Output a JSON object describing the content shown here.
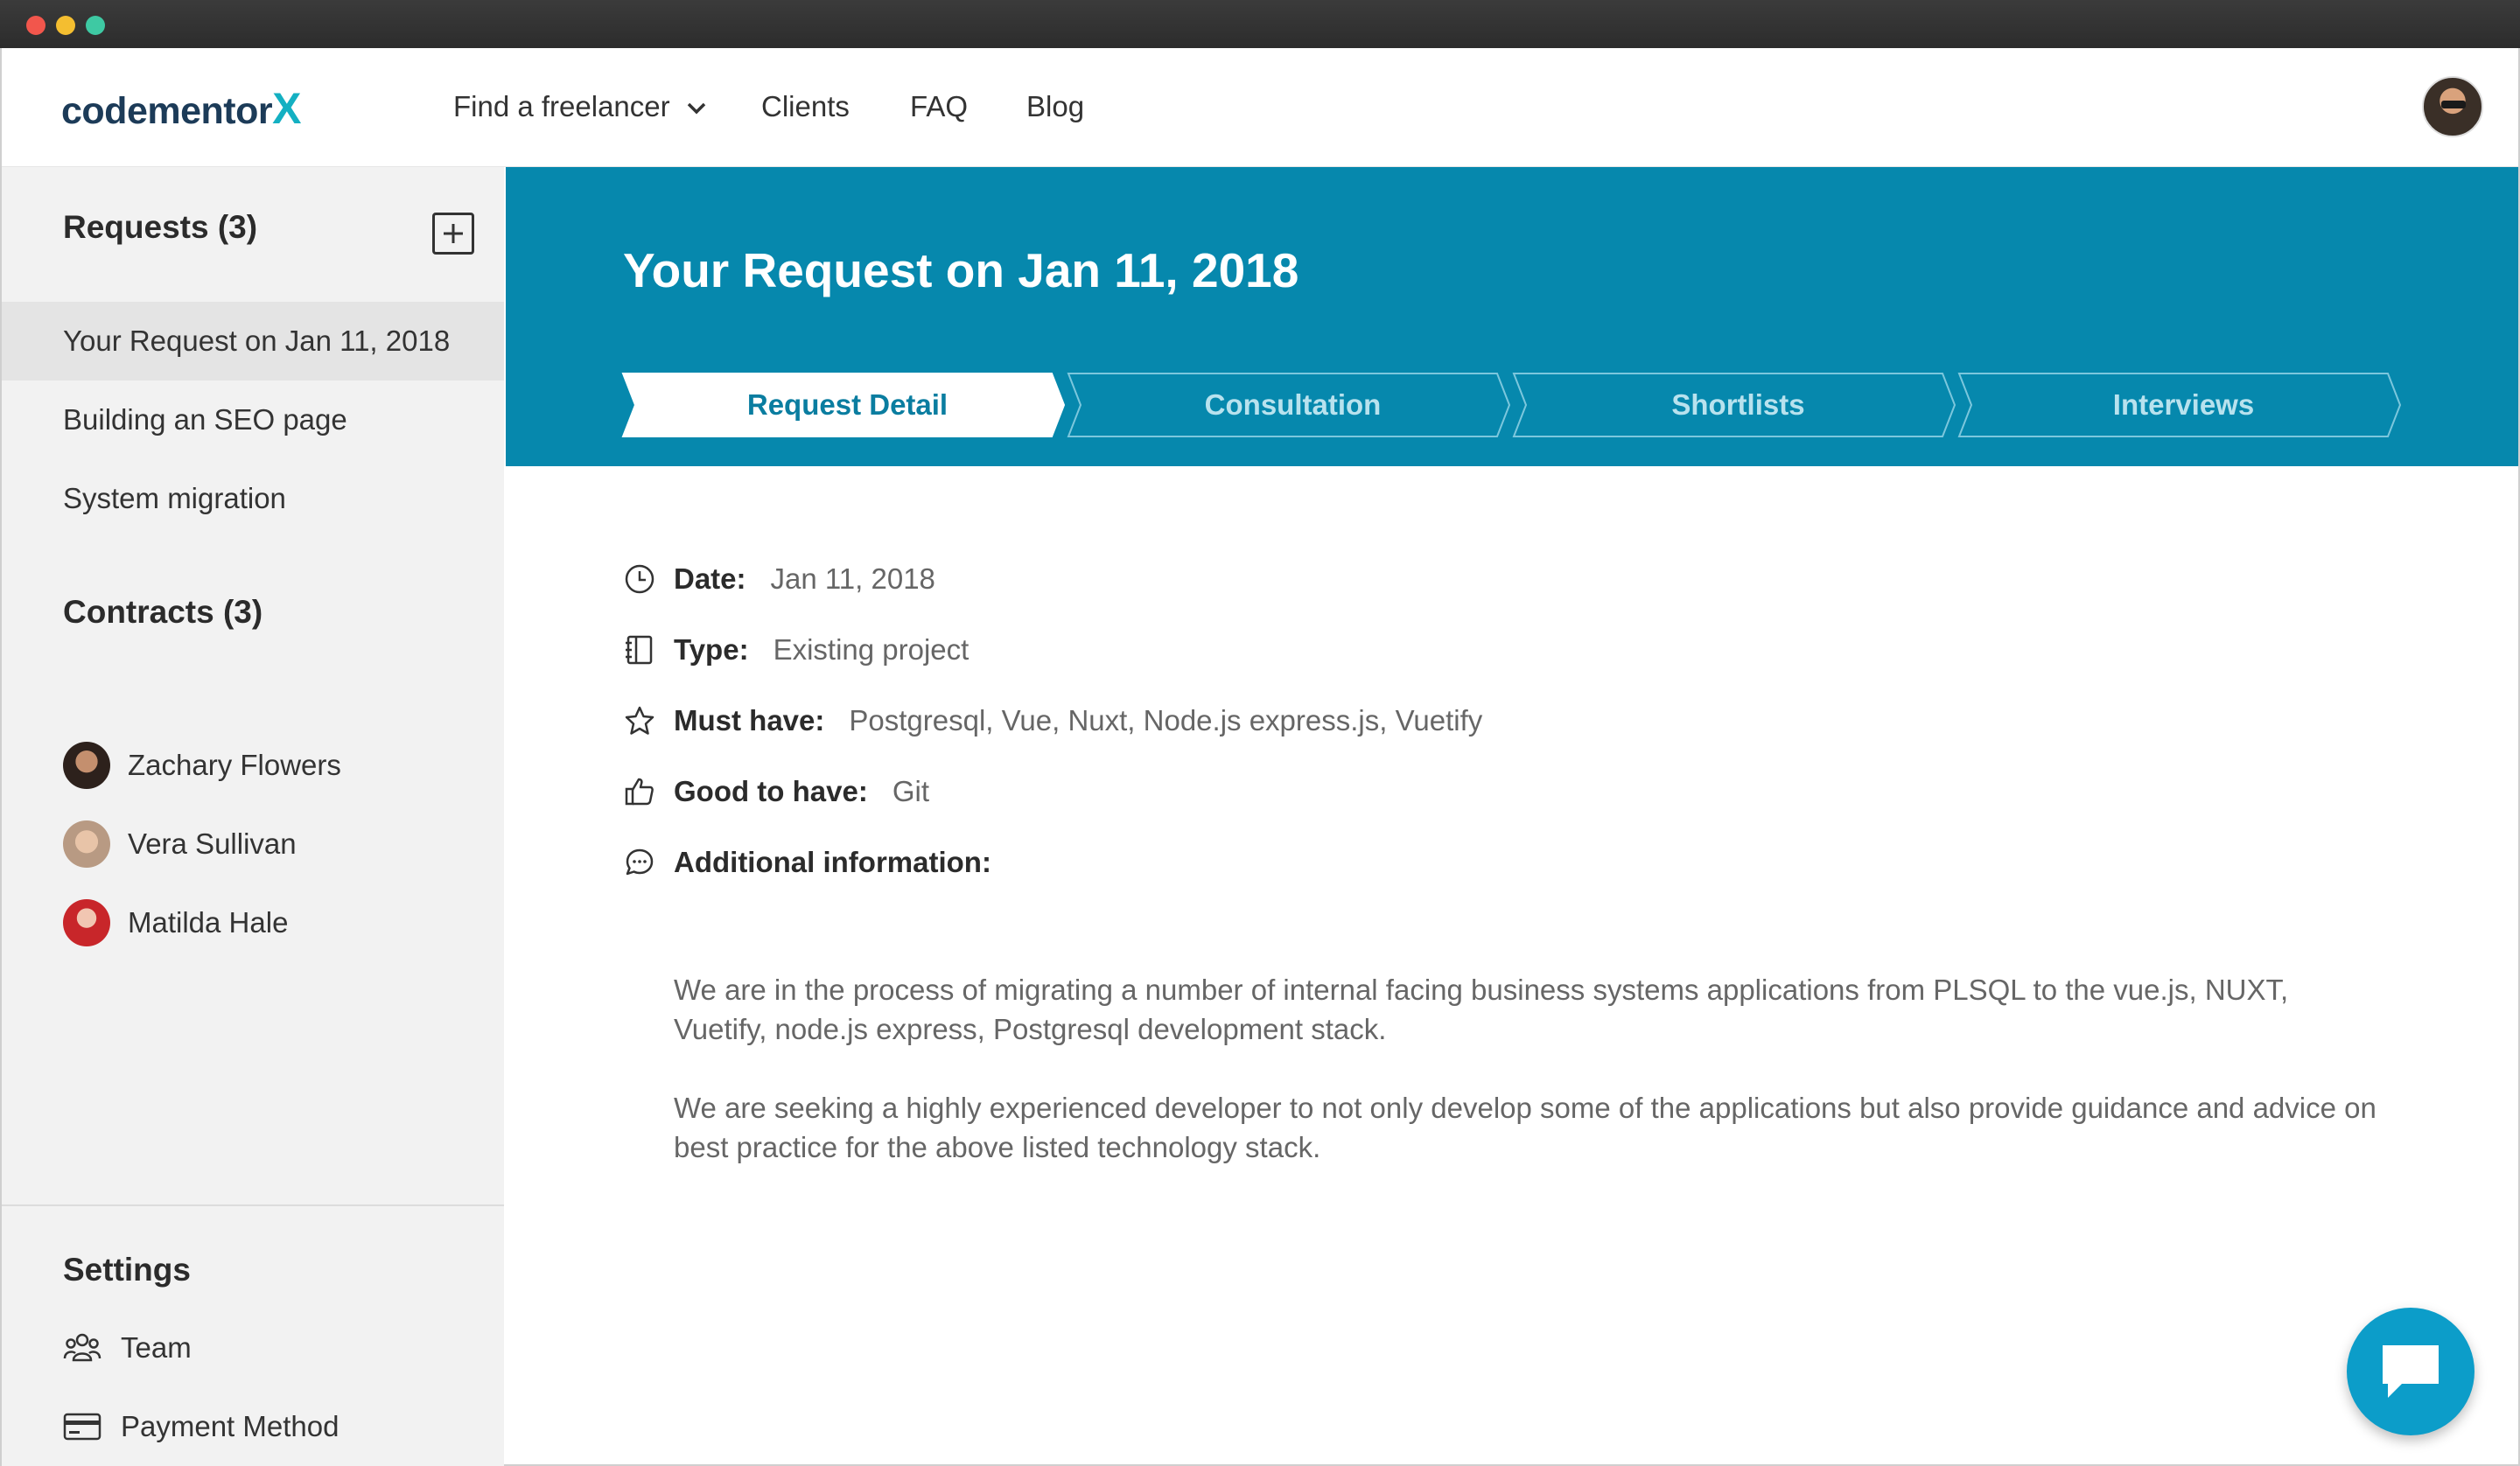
{
  "nav": {
    "logo_main": "codementor",
    "logo_x": "X",
    "find_freelancer": "Find a freelancer",
    "clients": "Clients",
    "faq": "FAQ",
    "blog": "Blog"
  },
  "sidebar": {
    "requests_heading": "Requests (3)",
    "requests": [
      {
        "label": "Your Request on Jan 11, 2018",
        "active": true
      },
      {
        "label": "Building an SEO page",
        "active": false
      },
      {
        "label": "System migration",
        "active": false
      }
    ],
    "contracts_heading": "Contracts (3)",
    "contracts": [
      {
        "name": "Zachary Flowers"
      },
      {
        "name": "Vera Sullivan"
      },
      {
        "name": "Matilda Hale"
      }
    ],
    "settings_heading": "Settings",
    "settings": [
      {
        "label": "Team",
        "icon": "team-icon"
      },
      {
        "label": "Payment Method",
        "icon": "credit-card-icon"
      }
    ]
  },
  "request": {
    "title": "Your Request on Jan 11, 2018",
    "steps": [
      {
        "label": "Request Detail",
        "active": true
      },
      {
        "label": "Consultation",
        "active": false
      },
      {
        "label": "Shortlists",
        "active": false
      },
      {
        "label": "Interviews",
        "active": false
      }
    ],
    "date_label": "Date:",
    "date_value": "Jan 11, 2018",
    "type_label": "Type:",
    "type_value": "Existing project",
    "must_label": "Must have:",
    "must_value": "Postgresql, Vue, Nuxt, Node.js express.js, Vuetify",
    "good_label": "Good to have:",
    "good_value": "Git",
    "info_label": "Additional information:",
    "info_paragraphs": [
      "We are in the process of migrating a number of internal facing business systems applications from PLSQL to the vue.js, NUXT, Vuetify, node.js express, Postgresql development stack.",
      "We are seeking a highly experienced developer to not only develop some of the applications but also provide guidance and advice on best practice for the above listed technology stack."
    ]
  },
  "colors": {
    "brand": "#0688ad",
    "logo_dark": "#1c3b58",
    "logo_accent": "#14b0c2",
    "chat": "#0c9dc9",
    "sidebar_bg": "#f2f2f2"
  }
}
